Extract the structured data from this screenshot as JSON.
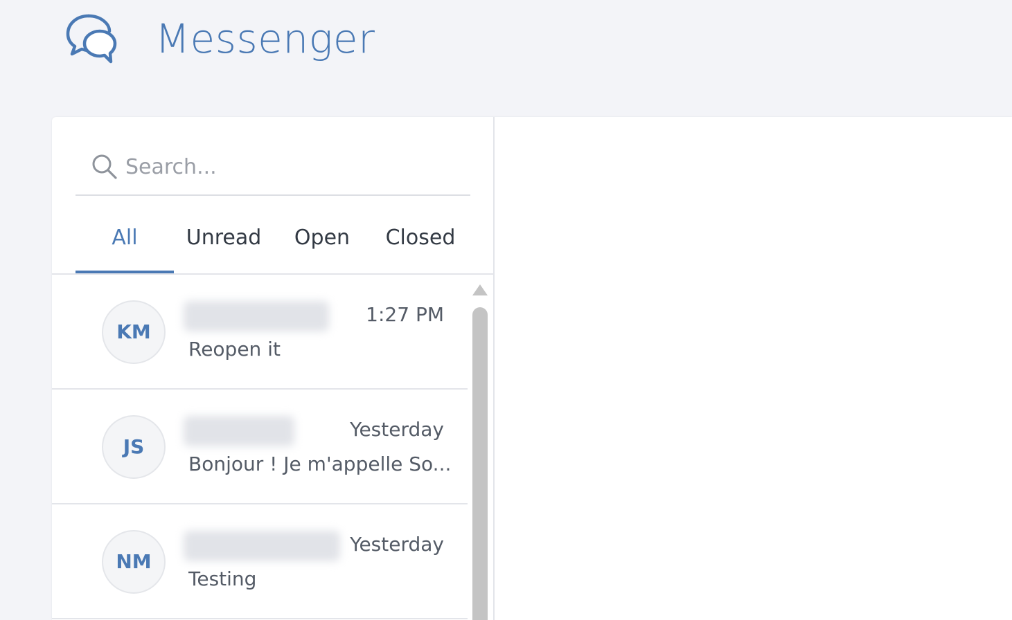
{
  "header": {
    "title": "Messenger",
    "logo_icon": "chat-bubbles-icon"
  },
  "search": {
    "placeholder": "Search..."
  },
  "tabs": [
    {
      "label": "All",
      "active": true
    },
    {
      "label": "Unread",
      "active": false
    },
    {
      "label": "Open",
      "active": false
    },
    {
      "label": "Closed",
      "active": false
    }
  ],
  "conversations": [
    {
      "initials": "KM",
      "time": "1:27 PM",
      "preview": "Reopen it",
      "name_redacted": true
    },
    {
      "initials": "JS",
      "time": "Yesterday",
      "preview": "Bonjour ! Je m'appelle So...",
      "name_redacted": true
    },
    {
      "initials": "NM",
      "time": "Yesterday",
      "preview": "Testing",
      "name_redacted": true
    }
  ],
  "colors": {
    "accent": "#4a79b4",
    "background": "#f3f4f8",
    "panel": "#ffffff",
    "divider": "#e3e5ea",
    "text": "#545b66"
  }
}
